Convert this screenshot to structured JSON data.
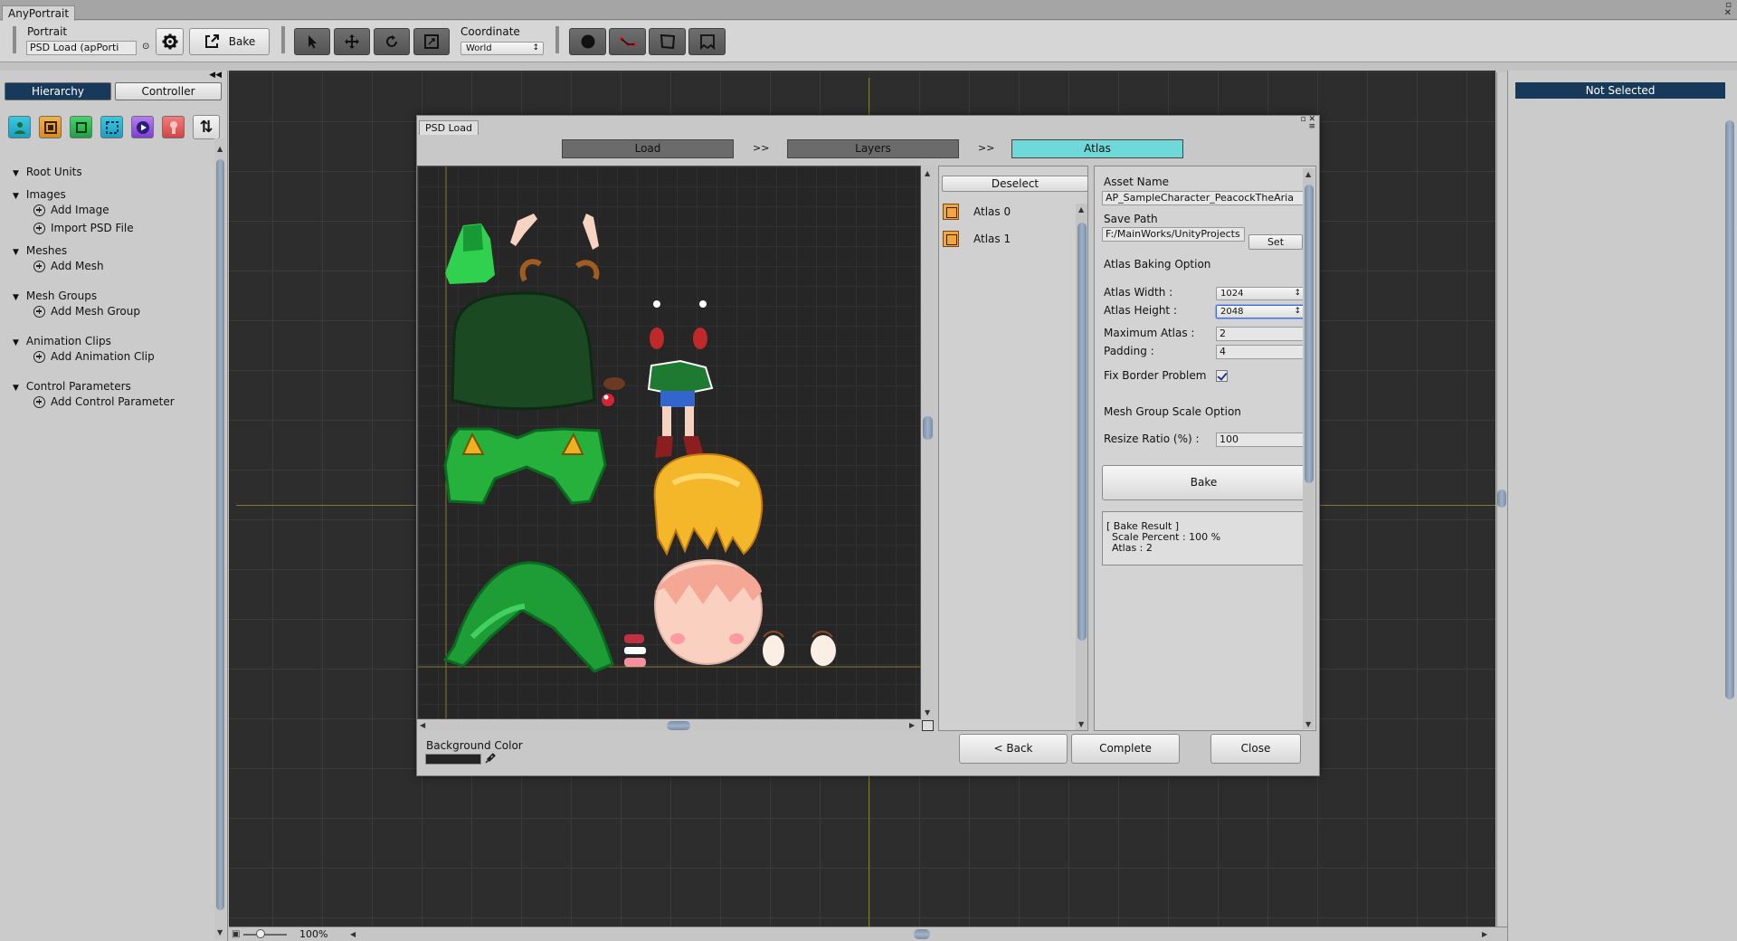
{
  "window": {
    "tab_title": "AnyPortrait"
  },
  "toolbar": {
    "portrait_label": "Portrait",
    "portrait_value": "PSD Load (apPorti",
    "bake_label": "Bake",
    "coordinate_label": "Coordinate",
    "coordinate_value": "World"
  },
  "left_panel": {
    "tabs": {
      "hierarchy": "Hierarchy",
      "controller": "Controller"
    },
    "tree": {
      "root_units": "Root Units",
      "images": "Images",
      "add_image": "Add Image",
      "import_psd": "Import PSD File",
      "meshes": "Meshes",
      "add_mesh": "Add Mesh",
      "mesh_groups": "Mesh Groups",
      "add_mesh_group": "Add Mesh Group",
      "animation_clips": "Animation Clips",
      "add_animation_clip": "Add Animation Clip",
      "control_parameters": "Control Parameters",
      "add_control_parameter": "Add Control Parameter"
    }
  },
  "workspace": {
    "zoom": "100%"
  },
  "right_panel": {
    "selection": "Not Selected"
  },
  "dialog": {
    "title": "PSD Load",
    "steps": {
      "load": "Load",
      "layers": "Layers",
      "atlas": "Atlas",
      "sep": ">>"
    },
    "deselect": "Deselect",
    "atlas_items": [
      "Atlas 0",
      "Atlas 1"
    ],
    "settings": {
      "asset_name_label": "Asset Name",
      "asset_name_value": "AP_SampleCharacter_PeacockTheAria",
      "save_path_label": "Save Path",
      "save_path_value": "F:/MainWorks/UnityProjects",
      "set_label": "Set",
      "baking_option": "Atlas Baking Option",
      "atlas_width_label": "Atlas Width :",
      "atlas_width_value": "1024",
      "atlas_height_label": "Atlas Height :",
      "atlas_height_value": "2048",
      "max_atlas_label": "Maximum Atlas :",
      "max_atlas_value": "2",
      "padding_label": "Padding :",
      "padding_value": "4",
      "fix_border_label": "Fix Border Problem",
      "scale_option": "Mesh Group Scale Option",
      "resize_label": "Resize Ratio (%) :",
      "resize_value": "100",
      "bake_label": "Bake",
      "result_title": "[ Bake Result ]",
      "result_scale": "Scale Percent : 100 %",
      "result_atlas": "Atlas : 2"
    },
    "footer": {
      "bg_color_label": "Background Color",
      "back": "< Back",
      "complete": "Complete",
      "close": "Close"
    }
  },
  "colors": {
    "selected_tab": "#183a5a",
    "active_step": "#6fd8d8",
    "workspace_bg": "#2d2d2d",
    "character_green": "#1e8a34",
    "hair_yellow": "#f5b72a",
    "skin": "#fad0c0"
  }
}
